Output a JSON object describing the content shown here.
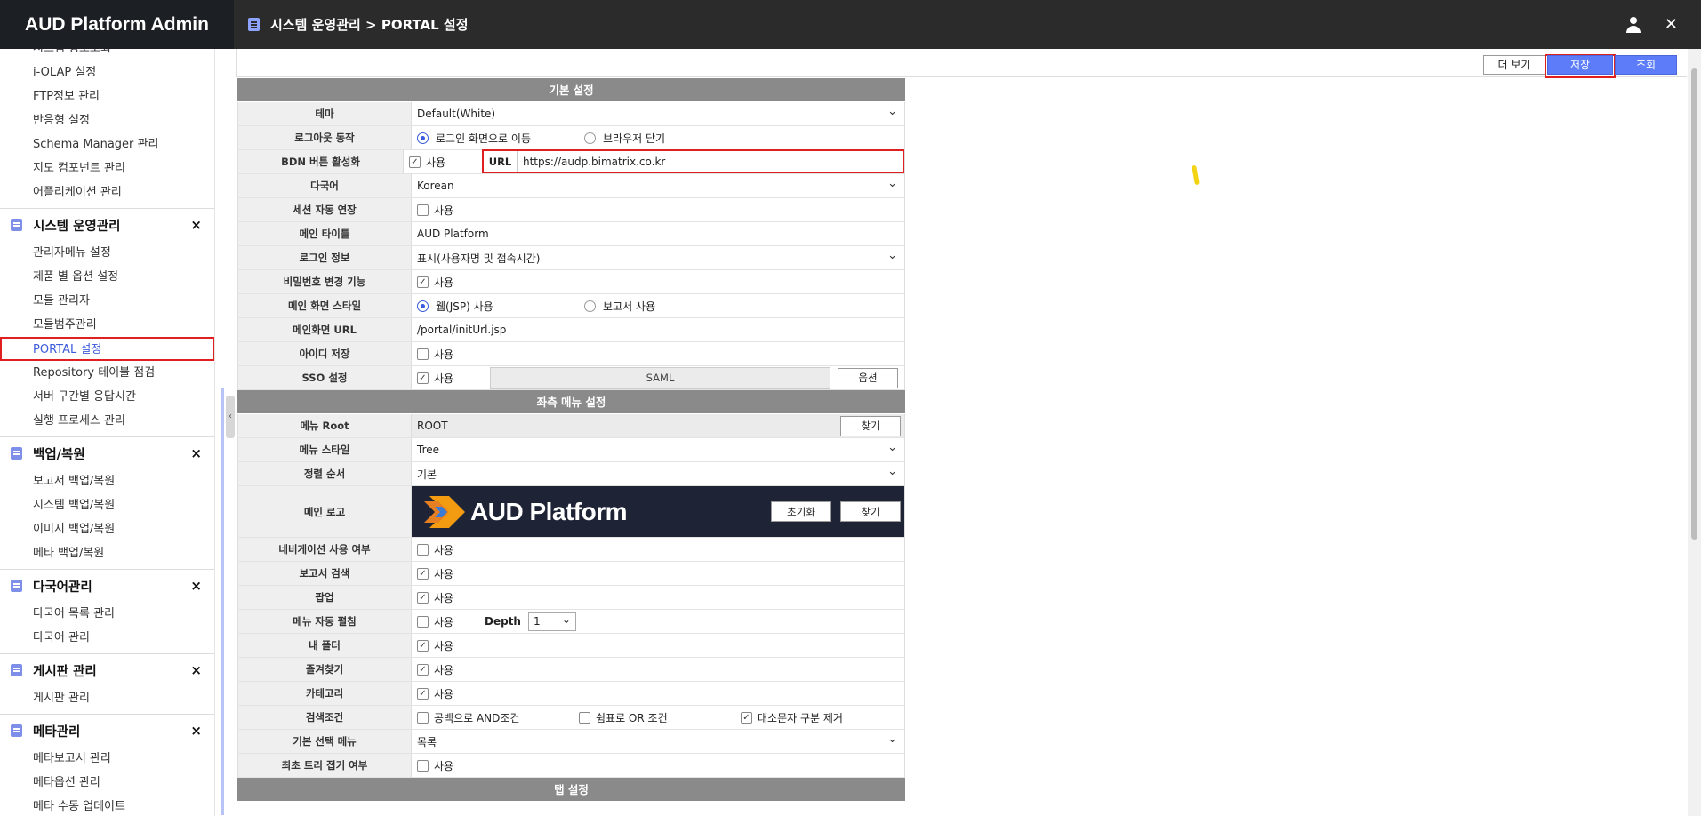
{
  "app_title": "AUD Platform Admin",
  "breadcrumb": "시스템 운영관리 > PORTAL 설정",
  "sidebar": {
    "top_items": [
      "시스템 정보조회",
      "i-OLAP 설정",
      "FTP정보 관리",
      "반응형 설정",
      "Schema Manager 관리",
      "지도 컴포넌트 관리",
      "어플리케이션 관리"
    ],
    "groups": [
      {
        "title": "시스템 운영관리",
        "items": [
          "관리자메뉴 설정",
          "제품 별 옵션 설정",
          "모듈 관리자",
          "모듈범주관리",
          "PORTAL 설정",
          "Repository 테이블 점검",
          "서버 구간별 응답시간",
          "실행 프로세스 관리"
        ]
      },
      {
        "title": "백업/복원",
        "items": [
          "보고서 백업/복원",
          "시스템 백업/복원",
          "이미지 백업/복원",
          "메타 백업/복원"
        ]
      },
      {
        "title": "다국어관리",
        "items": [
          "다국어 목록 관리",
          "다국어 관리"
        ]
      },
      {
        "title": "게시판 관리",
        "items": [
          "게시판 관리"
        ]
      },
      {
        "title": "메타관리",
        "items": [
          "메타보고서 관리",
          "메타옵션 관리",
          "메타 수동 업데이트"
        ]
      }
    ],
    "close_glyph": "×"
  },
  "toolbar": {
    "more_label": "더 보기",
    "save_label": "저장",
    "search_label": "조회"
  },
  "sections": {
    "basic": "기본 설정",
    "left_menu": "좌측 메뉴 설정",
    "tab": "탭 설정"
  },
  "form": {
    "theme": {
      "label": "테마",
      "value": "Default(White)"
    },
    "logout": {
      "label": "로그아웃 동작",
      "opt1": "로그인 화면으로 이동",
      "opt2": "브라우저 닫기"
    },
    "bdn": {
      "label": "BDN 버튼 활성화",
      "check": "사용",
      "url_label": "URL",
      "url_value": "https://audp.bimatrix.co.kr"
    },
    "lang": {
      "label": "다국어",
      "value": "Korean"
    },
    "session": {
      "label": "세션 자동 연장",
      "check": "사용"
    },
    "main_title": {
      "label": "메인 타이틀",
      "value": "AUD Platform"
    },
    "login_info": {
      "label": "로그인 정보",
      "value": "표시(사용자명 및 접속시간)"
    },
    "pw_change": {
      "label": "비밀번호 변경 기능",
      "check": "사용"
    },
    "main_style": {
      "label": "메인 화면 스타일",
      "opt1": "웹(JSP) 사용",
      "opt2": "보고서 사용"
    },
    "main_url": {
      "label": "메인화면 URL",
      "value": "/portal/initUrl.jsp"
    },
    "save_id": {
      "label": "아이디 저장",
      "check": "사용"
    },
    "sso": {
      "label": "SSO 설정",
      "check": "사용",
      "type": "SAML",
      "button": "옵션"
    },
    "menu_root": {
      "label": "메뉴 Root",
      "value": "ROOT",
      "button": "찾기"
    },
    "menu_style": {
      "label": "메뉴 스타일",
      "value": "Tree"
    },
    "sort": {
      "label": "정렬 순서",
      "value": "기본"
    },
    "main_logo": {
      "label": "메인 로고",
      "logo_text": "AUD Platform",
      "reset": "초기화",
      "find": "찾기"
    },
    "nav": {
      "label": "네비게이션 사용 여부",
      "check": "사용"
    },
    "report_search": {
      "label": "보고서 검색",
      "check": "사용"
    },
    "popup": {
      "label": "팝업",
      "check": "사용"
    },
    "menu_expand": {
      "label": "메뉴 자동 펼침",
      "check": "사용",
      "depth_label": "Depth",
      "depth_value": "1"
    },
    "my_folder": {
      "label": "내 폴더",
      "check": "사용"
    },
    "favorites": {
      "label": "즐겨찾기",
      "check": "사용"
    },
    "category": {
      "label": "카테고리",
      "check": "사용"
    },
    "search_cond": {
      "label": "검색조건",
      "opt1": "공백으로 AND조건",
      "opt2": "쉼표로 OR 조건",
      "opt3": "대소문자 구분 제거"
    },
    "default_menu": {
      "label": "기본 선택 메뉴",
      "value": "목록"
    },
    "tree_collapse": {
      "label": "최초 트리 접기 여부",
      "check": "사용"
    }
  },
  "colors": {
    "accent": "#5c7cfa",
    "highlight": "#e02020",
    "section_bg": "#8a8a8a",
    "topbar": "#2b2b2b"
  }
}
